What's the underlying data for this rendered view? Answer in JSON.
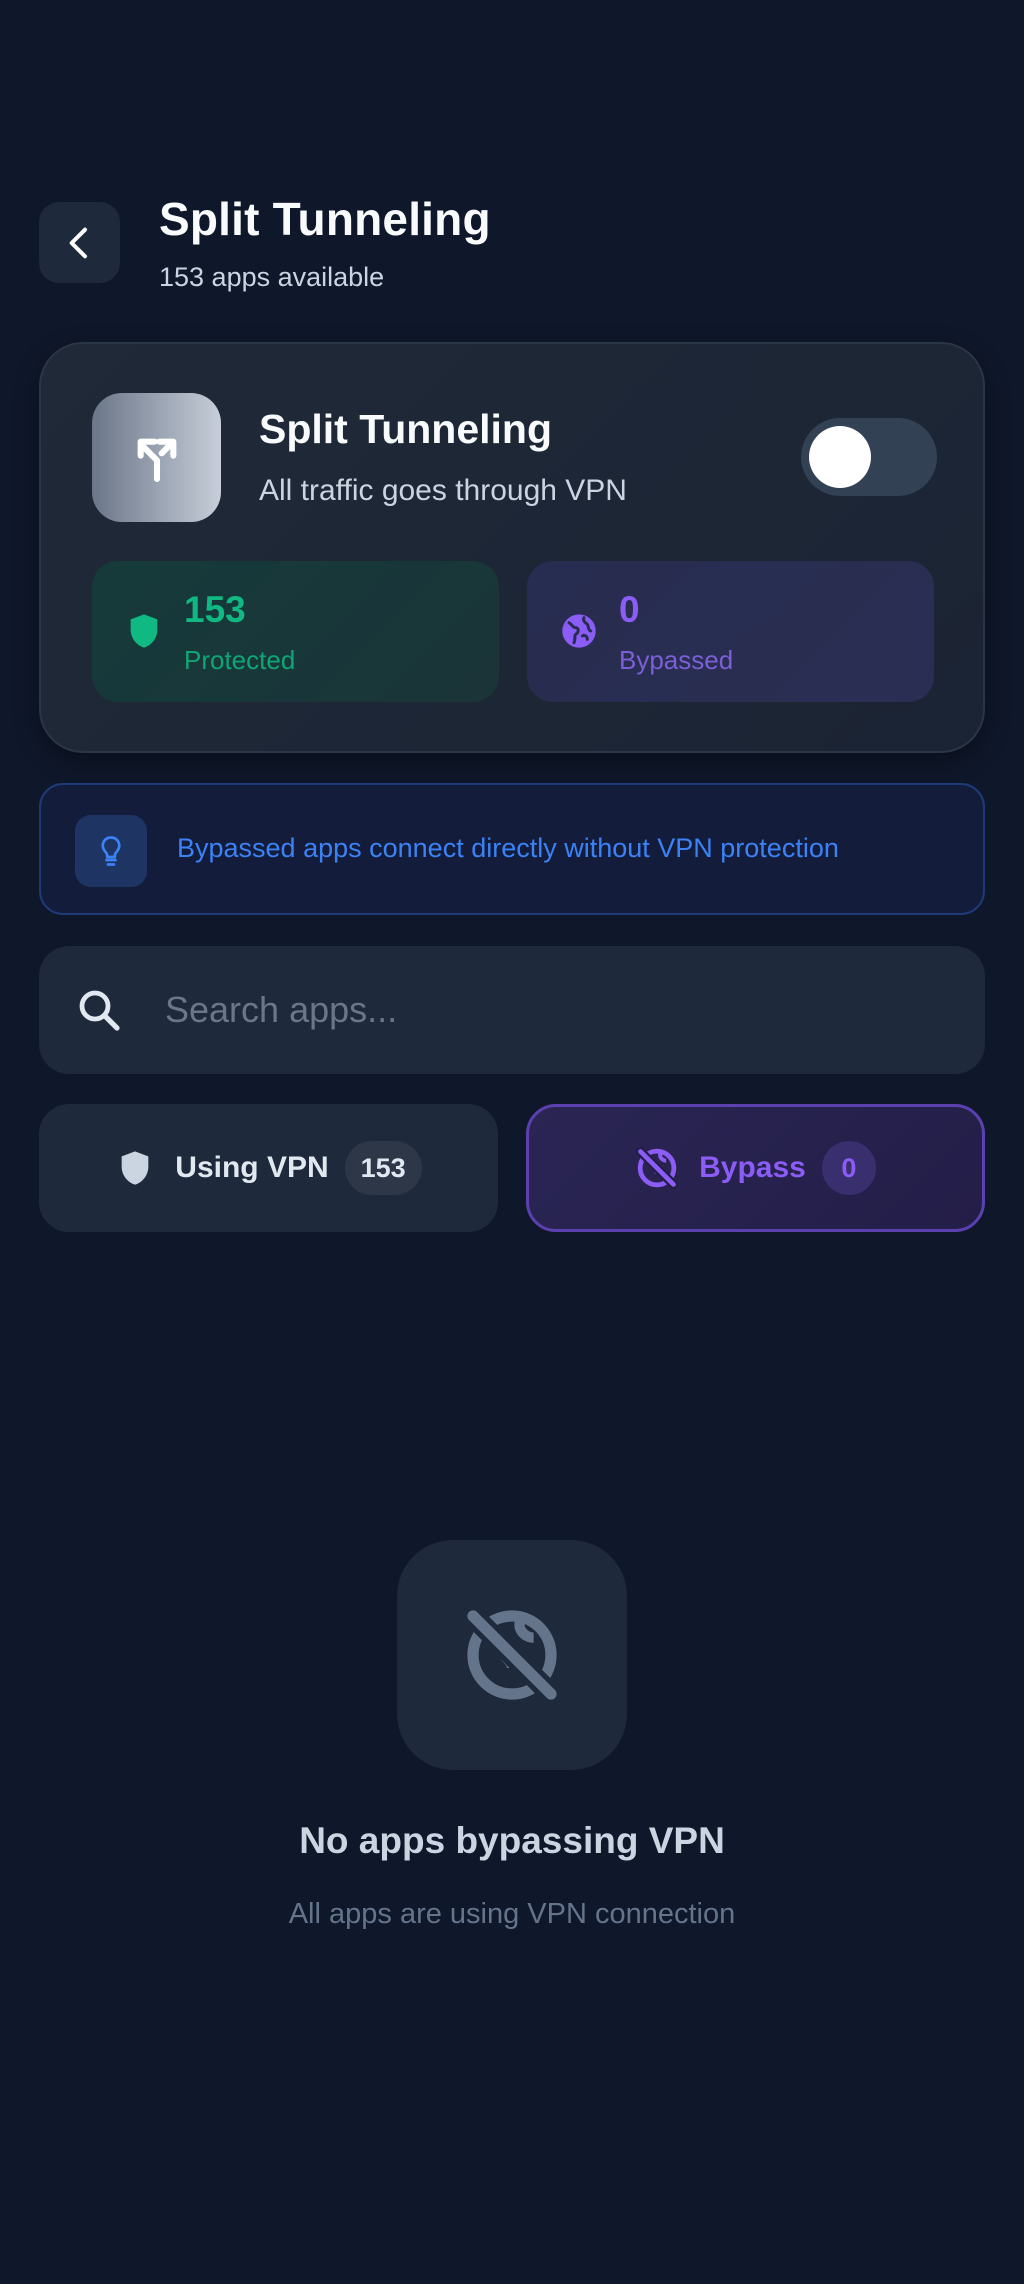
{
  "header": {
    "title": "Split Tunneling",
    "subtitle": "153 apps available"
  },
  "card": {
    "title": "Split Tunneling",
    "description": "All traffic goes through VPN",
    "toggle_on": false,
    "stats": {
      "protected": {
        "value": "153",
        "label": "Protected",
        "icon": "shield-icon"
      },
      "bypassed": {
        "value": "0",
        "label": "Bypassed",
        "icon": "globe-icon"
      }
    }
  },
  "info": {
    "icon": "lightbulb-icon",
    "text": "Bypassed apps connect directly without VPN protection"
  },
  "search": {
    "placeholder": "Search apps...",
    "value": ""
  },
  "tabs": [
    {
      "label": "Using VPN",
      "count": "153",
      "icon": "shield-icon",
      "active": false
    },
    {
      "label": "Bypass",
      "count": "0",
      "icon": "public-off-icon",
      "active": true
    }
  ],
  "empty_state": {
    "icon": "public-off-icon",
    "title": "No apps bypassing VPN",
    "subtitle": "All apps are using VPN connection"
  },
  "colors": {
    "background": "#0f172a",
    "surface": "#1e293b",
    "protected": "#10b981",
    "bypass": "#8b5cf6",
    "info": "#3b82f6"
  }
}
